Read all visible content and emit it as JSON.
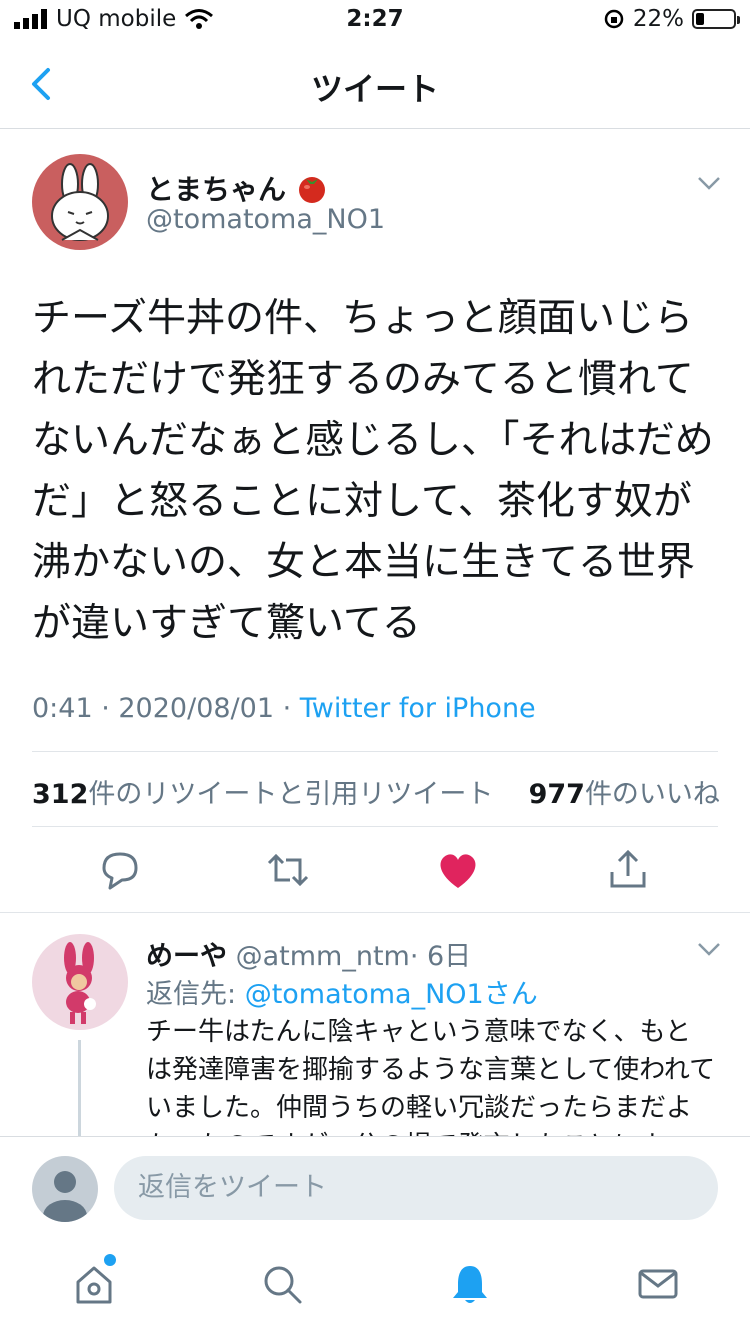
{
  "status": {
    "carrier": "UQ mobile",
    "time": "2:27",
    "battery": "22%"
  },
  "nav": {
    "title": "ツイート"
  },
  "tweet": {
    "name": "とまちゃん",
    "handle": "@tomatoma_NO1",
    "text": "チーズ牛丼の件、ちょっと顔面いじられただけで発狂するのみてると慣れてないんだなぁと感じるし、「それはだめだ」と怒ることに対して、茶化す奴が沸かないの、女と本当に生きてる世界が違いすぎて驚いてる",
    "time": "0:41 · 2020/08/01 · ",
    "source": "Twitter for iPhone",
    "retweets_count": "312",
    "retweets_label": "件のリツイートと引用リツイート",
    "likes_count": "977",
    "likes_label": "件のいいね"
  },
  "reply": {
    "name": "めーや",
    "handle": "@atmm_ntm",
    "time": "· 6日",
    "reply_to_label": "返信先: ",
    "reply_to_handle": "@tomatoma_NO1さん",
    "text": "チー牛はたんに陰キャという意味でなく、もとは発達障害を揶揄するような言葉として使われていました。仲間うちの軽い冗談だったらまだよかったのですが、公の場で発言したことによ"
  },
  "compose": {
    "placeholder": "返信をツイート"
  },
  "colors": {
    "accent": "#1da1f2",
    "like": "#e0245e",
    "secondary": "#657786"
  }
}
